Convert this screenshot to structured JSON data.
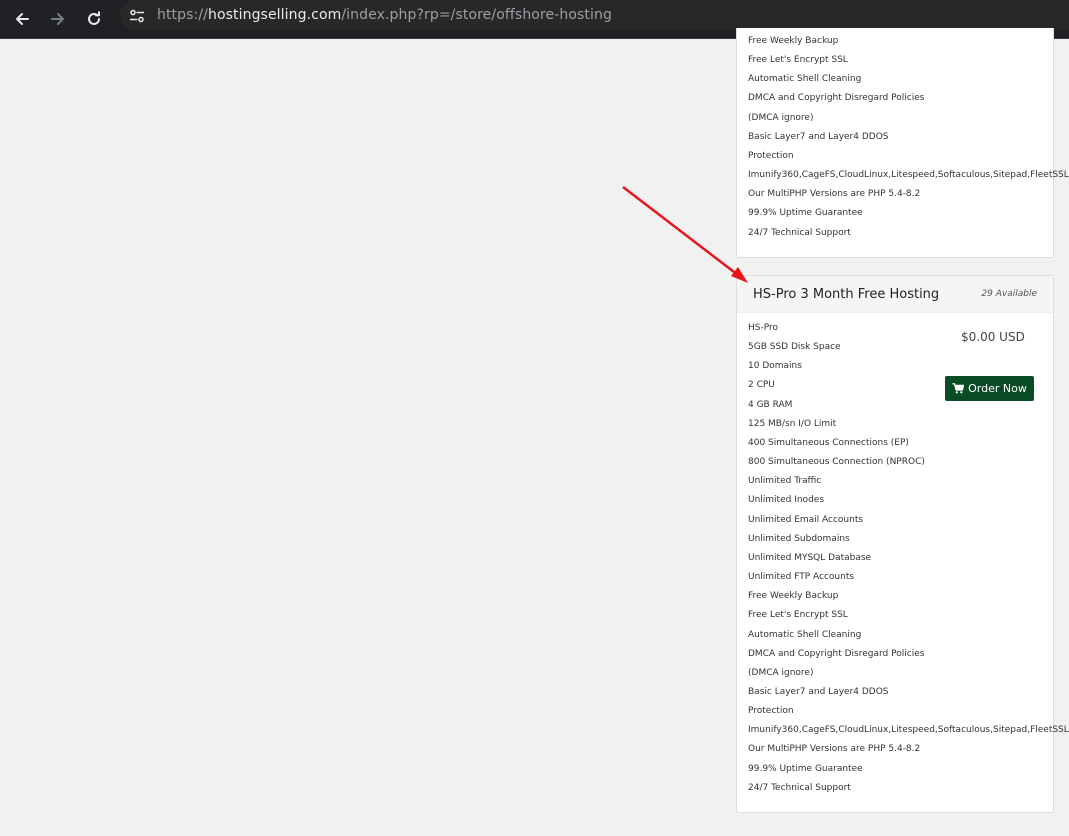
{
  "browser": {
    "url_prefix": "https://",
    "url_host": "hostingselling.com",
    "url_path": "/index.php?rp=/store/offshore-hosting",
    "icons": [
      "back-icon",
      "forward-icon",
      "reload-icon",
      "site-info-icon"
    ]
  },
  "top_card": {
    "features": [
      "Free Weekly Backup",
      "Free Let's Encrypt SSL",
      "Automatic Shell Cleaning",
      "DMCA and Copyright Disregard Policies",
      "(DMCA ignore)",
      "Basic Layer7 and Layer4 DDOS",
      "Protection",
      "Imunify360,CageFS,CloudLinux,Litespeed,Softaculous,Sitepad,FleetSSL",
      "Our MultiPHP Versions are PHP 5.4-8.2",
      "99.9% Uptime Guarantee",
      "24/7 Technical Support"
    ]
  },
  "product": {
    "title": "HS-Pro 3 Month Free Hosting",
    "availability": "29 Available",
    "price": "$0.00 USD",
    "order_label": "Order Now",
    "order_icon": "cart-icon",
    "features": [
      "HS-Pro",
      "5GB SSD Disk Space",
      "10 Domains",
      "2 CPU",
      "4 GB RAM",
      "125 MB/sn I/O Limit",
      "400 Simultaneous Connections (EP)",
      "800 Simultaneous Connection (NPROC)",
      "Unlimited Traffic",
      "Unlimited Inodes",
      "Unlimited Email Accounts",
      "Unlimited Subdomains",
      "Unlimited MYSQL Database",
      "Unlimited FTP Accounts",
      "Free Weekly Backup",
      "Free Let's Encrypt SSL",
      "Automatic Shell Cleaning",
      "DMCA and Copyright Disregard Policies",
      "(DMCA ignore)",
      "Basic Layer7 and Layer4 DDOS",
      "Protection",
      "Imunify360,CageFS,CloudLinux,Litespeed,Softaculous,Sitepad,FleetSSL",
      "Our MultiPHP Versions are PHP 5.4-8.2",
      "99.9% Uptime Guarantee",
      "24/7 Technical Support"
    ]
  },
  "colors": {
    "toolbar_bg": "#202124",
    "page_bg": "#f1f1f1",
    "order_button_bg": "#0a4d24",
    "annotation_arrow": "#e8141c"
  }
}
